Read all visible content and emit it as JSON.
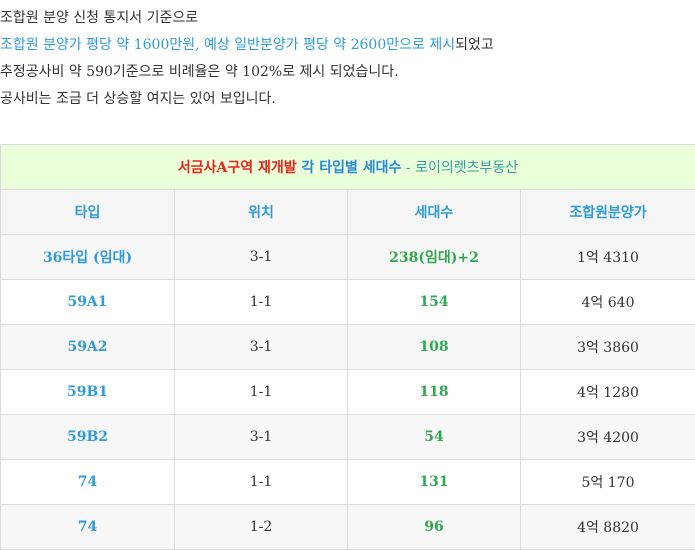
{
  "intro": {
    "line1": "조합원 분양 신청 통지서 기준으로",
    "line2_blue": "조합원 분양가 평당 약 1600만원, 예상 일반분양가 평당 약 2600만으로 제시",
    "line2_tail": "되었고",
    "line3": "추정공사비 약 590기준으로 비례율은 약 102%로 제시 되었습니다.",
    "line4": "공사비는 조금 더 상승할 여지는 있어 보입니다."
  },
  "table": {
    "title_red": "서금사A구역 재개발",
    "title_blue": " 각 타입별 세대수",
    "title_sep": " - ",
    "title_green": "로이의렛츠부동산",
    "headers": [
      "타입",
      "위치",
      "세대수",
      "조합원분양가"
    ],
    "rows": [
      {
        "type": "36타입 (임대)",
        "location": "3-1",
        "units": "238(임대)+2",
        "price": "1억 4310"
      },
      {
        "type": "59A1",
        "location": "1-1",
        "units": "154",
        "price": "4억 640"
      },
      {
        "type": "59A2",
        "location": "3-1",
        "units": "108",
        "price": "3억 3860"
      },
      {
        "type": "59B1",
        "location": "1-1",
        "units": "118",
        "price": "4억 1280"
      },
      {
        "type": "59B2",
        "location": "3-1",
        "units": "54",
        "price": "3억 4200"
      },
      {
        "type": "74",
        "location": "1-1",
        "units": "131",
        "price": "5억 170"
      },
      {
        "type": "74",
        "location": "1-2",
        "units": "96",
        "price": "4억 8820"
      }
    ]
  },
  "colors": {
    "accent_blue": "#2f9bd8",
    "title_red": "#e8241c",
    "units_green": "#2fa84f",
    "title_bg": "#eaffd9"
  }
}
